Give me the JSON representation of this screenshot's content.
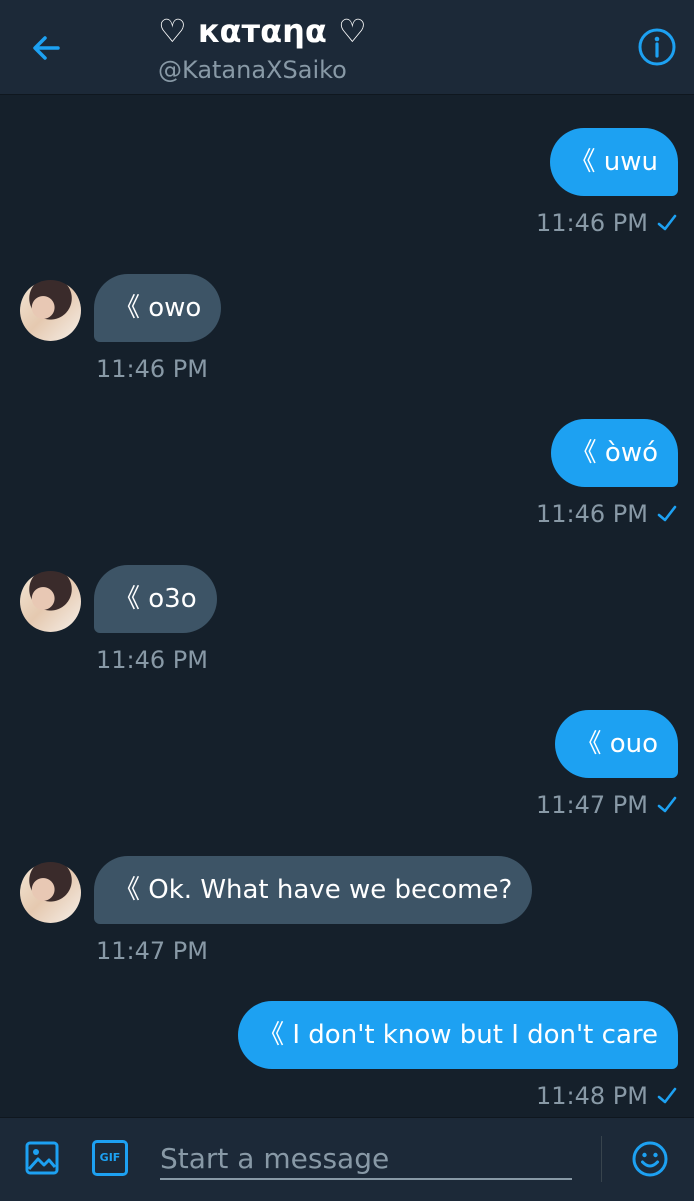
{
  "header": {
    "title": "♡ кαтαηα ♡",
    "handle": "@KatanaXSaiko",
    "back_icon": "arrow-left-icon",
    "info_icon": "info-icon"
  },
  "messages": [
    {
      "direction": "out",
      "text": "《 uwu",
      "time": "11:46 PM",
      "status": "sent-check"
    },
    {
      "direction": "in",
      "text": "《 owo",
      "time": "11:46 PM"
    },
    {
      "direction": "out",
      "text": "《 òwó",
      "time": "11:46 PM",
      "status": "sent-check"
    },
    {
      "direction": "in",
      "text": "《 o3o",
      "time": "11:46 PM"
    },
    {
      "direction": "out",
      "text": "《 ouo",
      "time": "11:47 PM",
      "status": "sent-check"
    },
    {
      "direction": "in",
      "text": "《 Ok. What have we become?",
      "time": "11:47 PM"
    },
    {
      "direction": "out",
      "text": "《 I don't know but I don't care",
      "time": "11:48 PM",
      "status": "sent-check"
    }
  ],
  "composer": {
    "placeholder": "Start a message",
    "gif_label": "GIF",
    "image_icon": "image-icon",
    "emoji_icon": "smiley-icon"
  },
  "colors": {
    "background": "#15202b",
    "header": "#1c2938",
    "accent": "#1da1f2",
    "incoming_bubble": "#3d5466",
    "muted_text": "#8899a6"
  }
}
